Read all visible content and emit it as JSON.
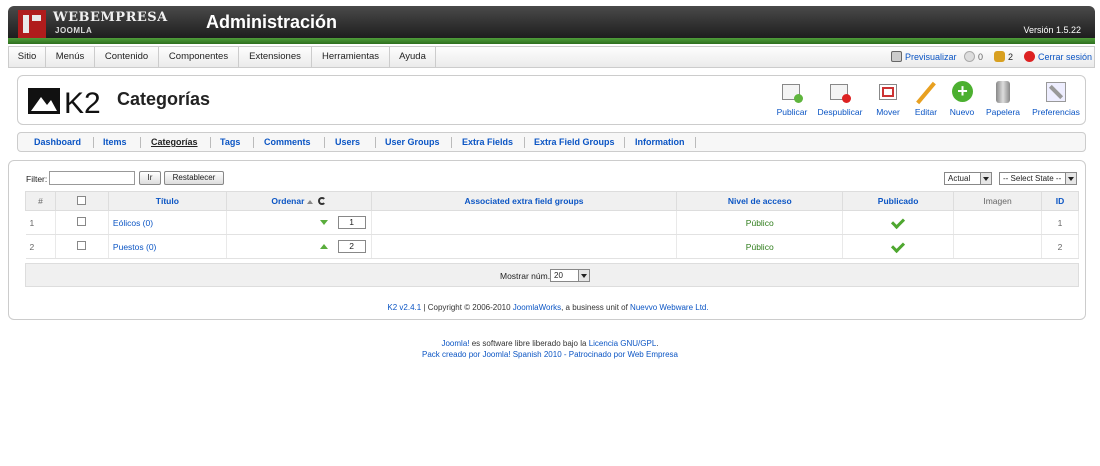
{
  "header": {
    "brand_top": "WEBEMPRESA",
    "brand_bottom": "JOOMLA",
    "title": "Administración",
    "version": "Versión 1.5.22"
  },
  "menu": {
    "items": [
      "Sitio",
      "Menús",
      "Contenido",
      "Componentes",
      "Extensiones",
      "Herramientas",
      "Ayuda"
    ],
    "preview": "Previsualizar",
    "messages_count": "0",
    "users_count": "2",
    "logout": "Cerrar sesión"
  },
  "page": {
    "title": "Categorías"
  },
  "toolbar": {
    "publish": "Publicar",
    "unpublish": "Despublicar",
    "move": "Mover",
    "edit": "Editar",
    "new": "Nuevo",
    "trash": "Papelera",
    "preferences": "Preferencias"
  },
  "submenu": {
    "items": [
      "Dashboard",
      "Items",
      "Categorías",
      "Tags",
      "Comments",
      "Users",
      "User Groups",
      "Extra Fields",
      "Extra Field Groups",
      "Information"
    ],
    "active": "Categorías"
  },
  "filter": {
    "label": "Filter:",
    "value": "",
    "go_button": "Ir",
    "reset_button": "Restablecer",
    "language_select": "Actual",
    "state_select": "-- Select State --"
  },
  "table": {
    "headers": {
      "num": "#",
      "title": "Título",
      "order": "Ordenar",
      "extra_groups": "Associated extra field groups",
      "access": "Nivel de acceso",
      "published": "Publicado",
      "image": "Imagen",
      "id": "ID"
    },
    "rows": [
      {
        "num": "1",
        "title": "Eólicos (0)",
        "order": "1",
        "extra_groups": "",
        "access": "Público",
        "published": true,
        "image": "",
        "id": "1"
      },
      {
        "num": "2",
        "title": "Puestos (0)",
        "order": "2",
        "extra_groups": "",
        "access": "Público",
        "published": true,
        "image": "",
        "id": "2"
      }
    ]
  },
  "pager": {
    "label": "Mostrar núm.",
    "value": "20"
  },
  "k2_footer": {
    "version": "K2 v2.4.1",
    "copyright": " | Copyright © 2006-2010 ",
    "joomlaworks": "JoomlaWorks",
    "business": ", a business unit of ",
    "nuevvo": "Nuevvo Webware Ltd."
  },
  "site_footer": {
    "joomla": "Joomla!",
    "text1": " es software libre liberado bajo la ",
    "license": "Licencia GNU/GPL",
    "text1_end": ".",
    "pack": "Pack creado por Joomla! Spanish 2010 - Patrocinado por Web Empresa"
  },
  "colors": {
    "link": "#0b55c4",
    "header_dark": "#1e1e1e",
    "header_green": "#2e6f1f",
    "published_green": "#4ea72f"
  }
}
